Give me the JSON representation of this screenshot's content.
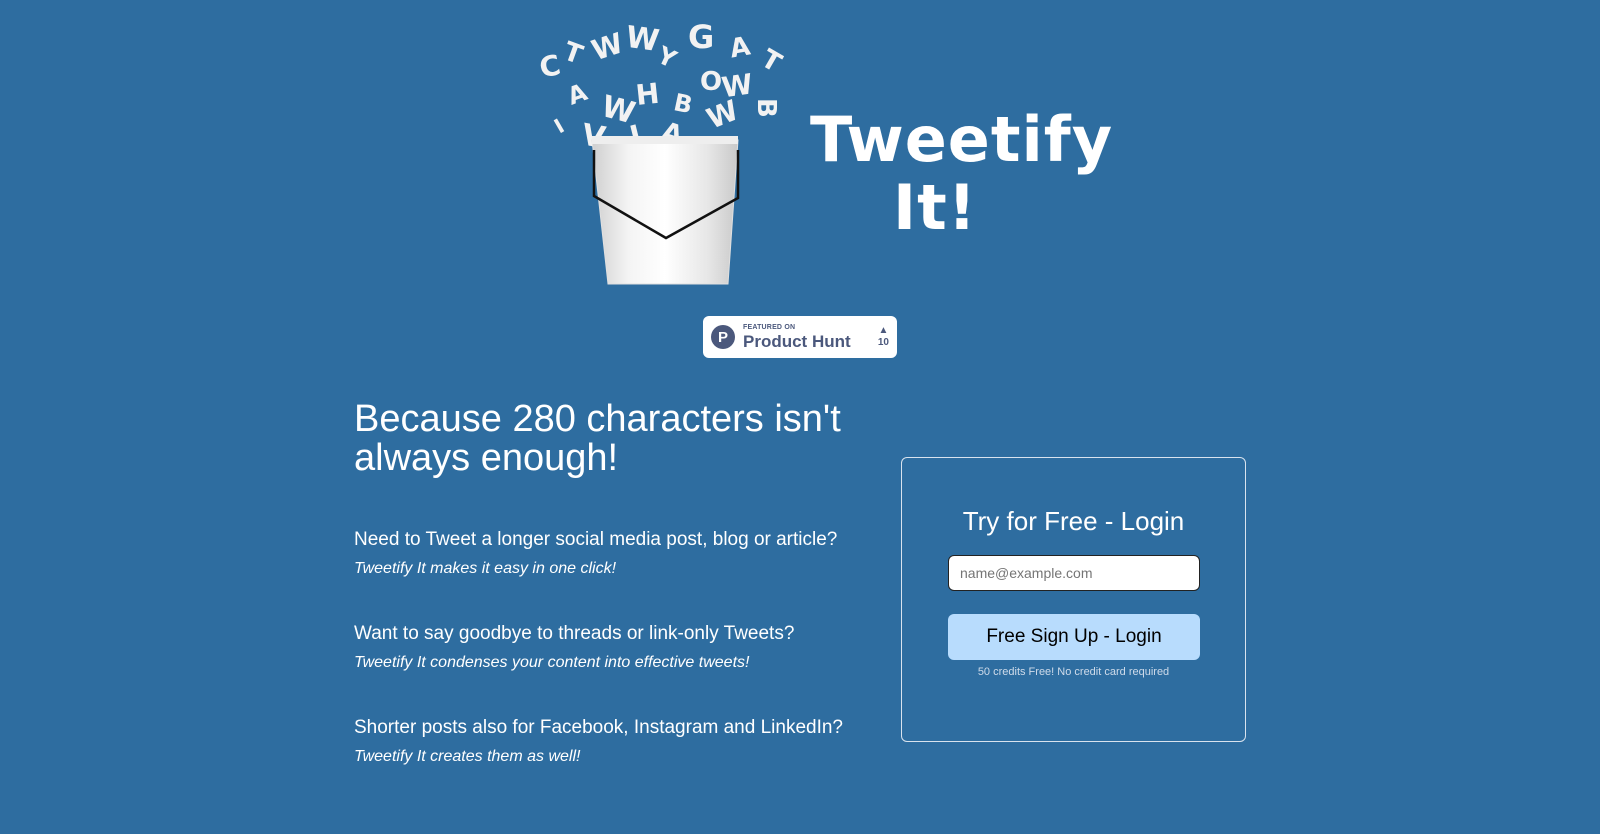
{
  "logo": {
    "title_line1": "Tweetify",
    "title_line2": "It!",
    "bucket_icon": "bucket-with-flying-letters",
    "flying_letters": "C T W Y G A T A W H O W B V W L A W"
  },
  "product_hunt_badge": {
    "featured_label": "FEATURED ON",
    "name": "Product Hunt",
    "logo_letter": "P",
    "vote_arrow": "▲",
    "votes": "10"
  },
  "hero": {
    "headline": "Because 280 characters isn't always enough!"
  },
  "features": [
    {
      "question": "Need to Tweet a longer social media post, blog or article?",
      "answer": "Tweetify It makes it easy in one click!"
    },
    {
      "question": "Want to say goodbye to threads or link-only Tweets?",
      "answer": "Tweetify It condenses your content into effective tweets!"
    },
    {
      "question": "Shorter posts also for Facebook, Instagram and LinkedIn?",
      "answer": "Tweetify It creates them as well!"
    }
  ],
  "signup": {
    "title": "Try for Free - Login",
    "email_placeholder": "name@example.com",
    "email_value": "",
    "button_label": "Free Sign Up - Login",
    "note": "50 credits Free! No credit card required"
  },
  "colors": {
    "background": "#2e6da0",
    "button_bg": "#b8dcfd",
    "product_hunt": "#4b587c",
    "text": "#ffffff"
  }
}
